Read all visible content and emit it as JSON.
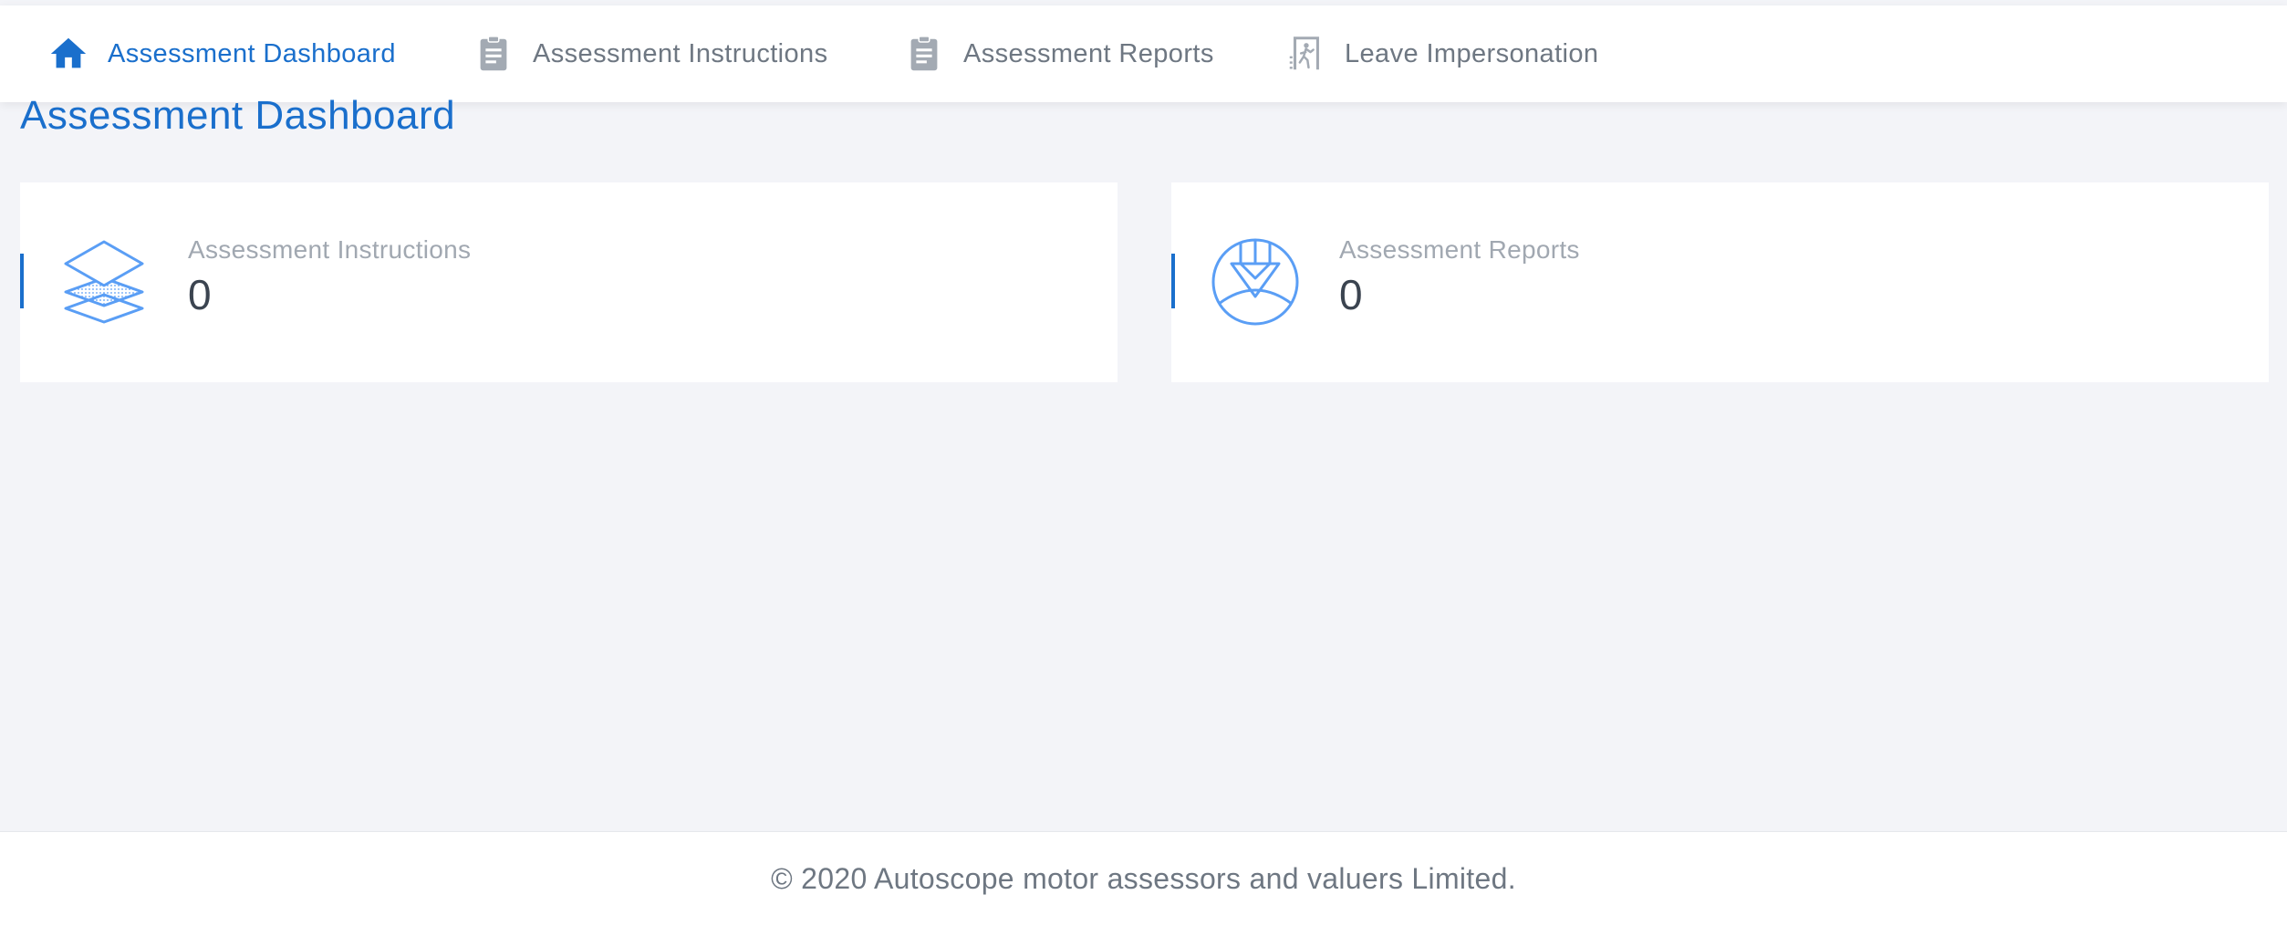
{
  "nav": {
    "items": [
      {
        "label": "Assessment Dashboard",
        "icon": "home-icon",
        "active": true
      },
      {
        "label": "Assessment Instructions",
        "icon": "clipboard-icon",
        "active": false
      },
      {
        "label": "Assessment Reports",
        "icon": "clipboard-icon",
        "active": false
      },
      {
        "label": "Leave Impersonation",
        "icon": "exit-door-icon",
        "active": false
      }
    ]
  },
  "page": {
    "title": "Assessment Dashboard"
  },
  "cards": [
    {
      "label": "Assessment Instructions",
      "count": "0",
      "icon": "layers-icon"
    },
    {
      "label": "Assessment Reports",
      "count": "0",
      "icon": "pen-nib-circle-icon"
    }
  ],
  "footer": {
    "text": "© 2020 Autoscope motor assessors and valuers Limited."
  },
  "colors": {
    "accent": "#1a6fcc",
    "nav_text": "#6e7782",
    "icon_light_blue": "#5a9ef5",
    "background": "#f3f4f8"
  }
}
